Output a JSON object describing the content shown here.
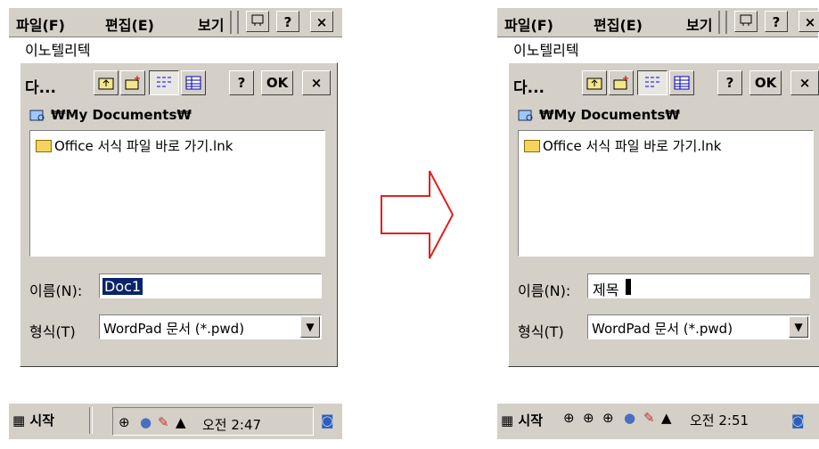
{
  "left": {
    "menubar": {
      "file": "파일(F)",
      "edit": "편집(E)",
      "view": "보기",
      "help": "?",
      "close": "×"
    },
    "company": "이노텔리텍",
    "dialog": {
      "title": "다...",
      "help": "?",
      "ok": "OK",
      "close": "×",
      "path": "₩My Documents₩",
      "file_item": "Office 서식 파일 바로 가기.lnk",
      "name_label": "이름(N):",
      "name_value": "Doc1",
      "type_label": "형식(T)",
      "type_value": "WordPad 문서 (*.pwd)"
    },
    "taskbar": {
      "start": "시작",
      "clock": "오전 2:47"
    }
  },
  "right": {
    "menubar": {
      "file": "파일(F)",
      "edit": "편집(E)",
      "view": "보기",
      "help": "?",
      "close": "×"
    },
    "company": "이노텔리텍",
    "dialog": {
      "title": "다...",
      "help": "?",
      "ok": "OK",
      "close": "×",
      "path": "₩My Documents₩",
      "file_item": "Office 서식 파일 바로 가기.lnk",
      "name_label": "이름(N):",
      "name_value": "제목",
      "type_label": "형식(T)",
      "type_value": "WordPad 문서 (*.pwd)"
    },
    "taskbar": {
      "start": "시작",
      "clock": "오전 2:51"
    }
  },
  "colors": {
    "arrow": "#e02020",
    "chrome": "#d4d0c8",
    "selection": "#0a246a"
  }
}
